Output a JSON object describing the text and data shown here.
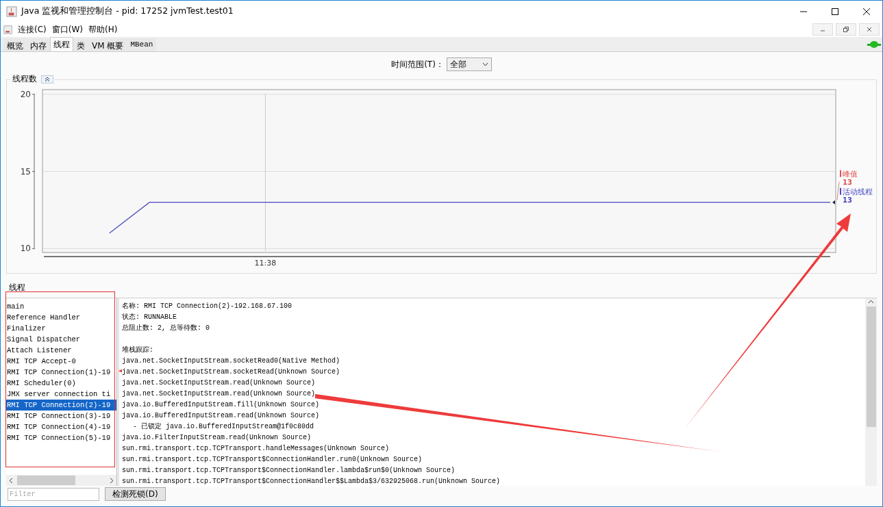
{
  "window": {
    "title": "Java 监视和管理控制台 - pid: 17252 jvmTest.test01"
  },
  "menu": [
    {
      "label": "连接(C)"
    },
    {
      "label": "窗口(W)"
    },
    {
      "label": "帮助(H)"
    }
  ],
  "tabs": [
    {
      "label": "概览",
      "selected": false
    },
    {
      "label": "内存",
      "selected": false
    },
    {
      "label": "线程",
      "selected": true
    },
    {
      "label": "类",
      "selected": false
    },
    {
      "label": "VM 概要",
      "selected": false
    },
    {
      "label": "MBean",
      "selected": false
    }
  ],
  "time_range": {
    "label": "时间范围(T)：",
    "value": "全部"
  },
  "thread_chart": {
    "title": "线程数",
    "peak": {
      "label": "峰值",
      "value": "13",
      "color": "#e05050"
    },
    "current_value": "13",
    "chart_data": {
      "type": "line",
      "ylim": [
        9.75,
        20.3
      ],
      "yticks": [
        {
          "value": 10,
          "label": "10"
        },
        {
          "value": 15,
          "label": "15"
        },
        {
          "value": 20,
          "label": "20"
        }
      ],
      "grid": true,
      "legend": "right",
      "annotations": [
        "11:38"
      ],
      "series": [
        {
          "name": "活动线程",
          "color": "#4848c0",
          "values": [
            11,
            13,
            13,
            13,
            13,
            13,
            13,
            13,
            13,
            13,
            13,
            13,
            13,
            13,
            13,
            13,
            13,
            13,
            13
          ]
        }
      ]
    }
  },
  "threads": {
    "title": "线程",
    "items": [
      {
        "name": "main",
        "selected": false
      },
      {
        "name": "Reference Handler",
        "selected": false
      },
      {
        "name": "Finalizer",
        "selected": false
      },
      {
        "name": "Signal Dispatcher",
        "selected": false
      },
      {
        "name": "Attach Listener",
        "selected": false
      },
      {
        "name": "RMI TCP Accept-0",
        "selected": false
      },
      {
        "name": "RMI TCP Connection(1)-19",
        "selected": false
      },
      {
        "name": "RMI Scheduler(0)",
        "selected": false
      },
      {
        "name": "JMX server connection ti",
        "selected": false
      },
      {
        "name": "RMI TCP Connection(2)-19",
        "selected": true
      },
      {
        "name": "RMI TCP Connection(3)-19",
        "selected": false
      },
      {
        "name": "RMI TCP Connection(4)-19",
        "selected": false
      },
      {
        "name": "RMI TCP Connection(5)-19",
        "selected": false
      }
    ],
    "filter": {
      "placeholder": "Filter"
    },
    "detect_button": "检测死锁(D)"
  },
  "details": {
    "info": [
      "名称: RMI TCP Connection(2)-192.168.67.100",
      "状态: RUNNABLE",
      "总阻止数: 2, 总等待数: 0"
    ],
    "stack_title": "堆栈跟踪:",
    "stack": [
      {
        "kind": "frame",
        "text": "java.net.SocketInputStream.socketRead0(Native Method)"
      },
      {
        "kind": "frame",
        "text": "java.net.SocketInputStream.socketRead(Unknown Source)"
      },
      {
        "kind": "frame",
        "text": "java.net.SocketInputStream.read(Unknown Source)"
      },
      {
        "kind": "frame",
        "text": "java.net.SocketInputStream.read(Unknown Source)"
      },
      {
        "kind": "frame",
        "text": "java.io.BufferedInputStream.fill(Unknown Source)"
      },
      {
        "kind": "frame",
        "text": "java.io.BufferedInputStream.read(Unknown Source)"
      },
      {
        "kind": "lock",
        "text": "- 已锁定 java.io.BufferedInputStream@1f0c80dd"
      },
      {
        "kind": "frame",
        "text": "java.io.FilterInputStream.read(Unknown Source)"
      },
      {
        "kind": "frame",
        "text": "sun.rmi.transport.tcp.TCPTransport.handleMessages(Unknown Source)"
      },
      {
        "kind": "frame",
        "text": "sun.rmi.transport.tcp.TCPTransport$ConnectionHandler.run0(Unknown Source)"
      },
      {
        "kind": "frame",
        "text": "sun.rmi.transport.tcp.TCPTransport$ConnectionHandler.lambda$run$0(Unknown Source)"
      },
      {
        "kind": "frame",
        "text": "sun.rmi.transport.tcp.TCPTransport$ConnectionHandler$$Lambda$3/632925068.run(Unknown Source)"
      }
    ]
  }
}
